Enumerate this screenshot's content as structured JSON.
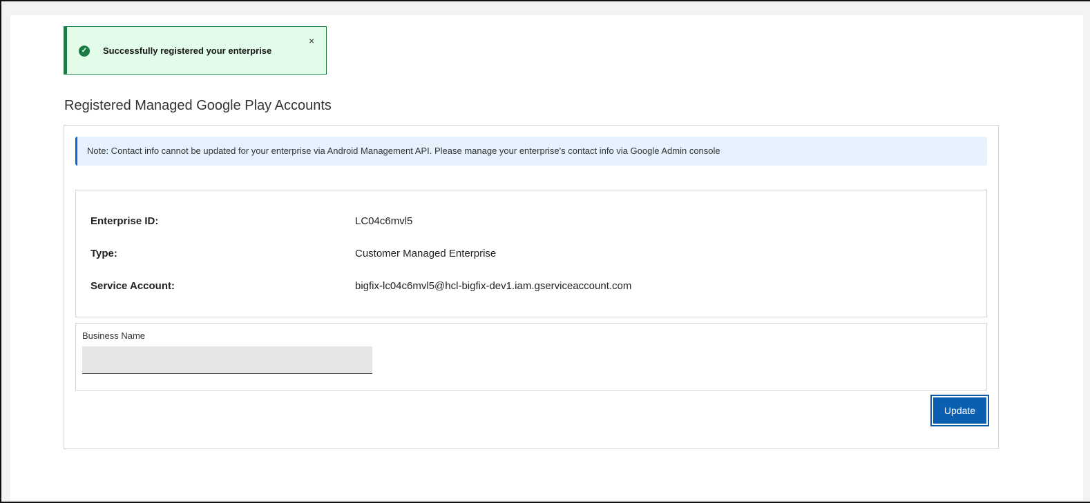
{
  "toast": {
    "message": "Successfully registered your enterprise",
    "close_label": "×",
    "icon": "check-circle-icon",
    "color": "#197a43"
  },
  "page_title": "Registered Managed Google Play Accounts",
  "note": "Note: Contact info cannot be updated for your enterprise via Android Management API. Please manage your enterprise's contact info via Google Admin console",
  "details": [
    {
      "label": "Enterprise ID:",
      "value": "LC04c6mvl5"
    },
    {
      "label": "Type:",
      "value": "Customer Managed Enterprise"
    },
    {
      "label": "Service Account:",
      "value": "bigfix-lc04c6mvl5@hcl-bigfix-dev1.iam.gserviceaccount.com"
    }
  ],
  "business_name": {
    "label": "Business Name",
    "value": ""
  },
  "update_button": "Update"
}
